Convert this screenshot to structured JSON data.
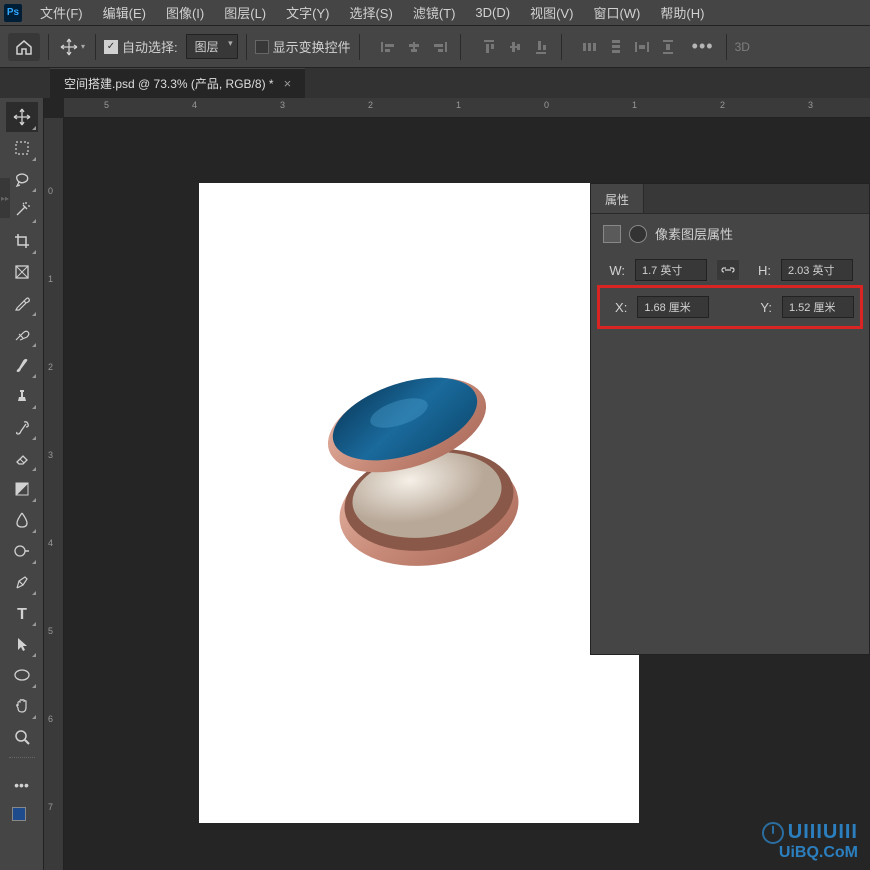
{
  "app": {
    "logo": "Ps"
  },
  "menu": {
    "file": "文件(F)",
    "edit": "编辑(E)",
    "image": "图像(I)",
    "layer": "图层(L)",
    "type": "文字(Y)",
    "select": "选择(S)",
    "filter": "滤镜(T)",
    "threeD": "3D(D)",
    "view": "视图(V)",
    "window": "窗口(W)",
    "help": "帮助(H)"
  },
  "options": {
    "auto_select": "自动选择:",
    "target_dropdown": "图层",
    "show_transform": "显示变换控件",
    "threeD_label": "3D"
  },
  "document": {
    "tab_title": "空间搭建.psd @ 73.3% (产品, RGB/8) *"
  },
  "rulers": {
    "h": [
      "5",
      "4",
      "3",
      "2",
      "1",
      "0",
      "1",
      "2",
      "3"
    ],
    "v": [
      "0",
      "1",
      "2",
      "3",
      "4",
      "5",
      "6",
      "7"
    ]
  },
  "properties": {
    "tab": "属性",
    "header": "像素图层属性",
    "w_label": "W:",
    "w_value": "1.7 英寸",
    "h_label": "H:",
    "h_value": "2.03 英寸",
    "x_label": "X:",
    "x_value": "1.68 厘米",
    "y_label": "Y:",
    "y_value": "1.52 厘米"
  },
  "watermark": {
    "line1": "UIIIUIII",
    "line2": "UiBQ.CoM"
  }
}
